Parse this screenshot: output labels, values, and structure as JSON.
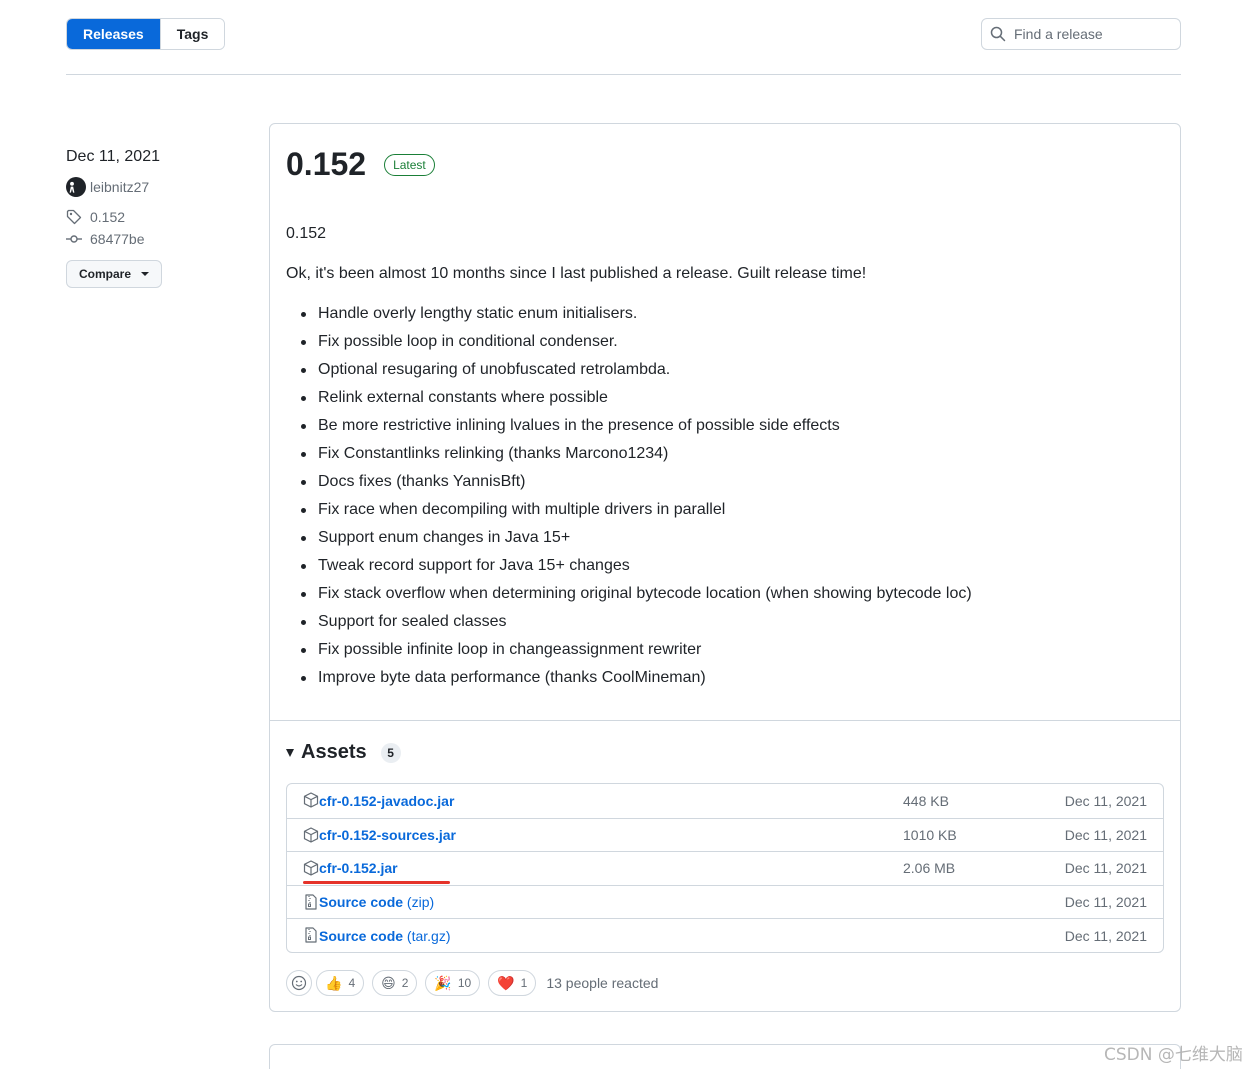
{
  "tabs": [
    {
      "label": "Releases",
      "active": true
    },
    {
      "label": "Tags",
      "active": false
    }
  ],
  "search": {
    "placeholder": "Find a release",
    "icon": "search-icon"
  },
  "release": {
    "date": "Dec 11, 2021",
    "author": "leibnitz27",
    "tag": "0.152",
    "commit": "68477be",
    "compare_label": "Compare",
    "version": "0.152",
    "latest_label": "Latest",
    "body": {
      "heading": "0.152",
      "intro": "Ok, it's been almost 10 months since I last published a release. Guilt release time!",
      "items": [
        "Handle overly lengthy static enum initialisers.",
        "Fix possible loop in conditional condenser.",
        "Optional resugaring of unobfuscated retrolambda.",
        "Relink external constants where possible",
        "Be more restrictive inlining lvalues in the presence of possible side effects",
        "Fix Constantlinks relinking (thanks Marcono1234)",
        "Docs fixes (thanks YannisBft)",
        "Fix race when decompiling with multiple drivers in parallel",
        "Support enum changes in Java 15+",
        "Tweak record support for Java 15+ changes",
        "Fix stack overflow when determining original bytecode location (when showing bytecode loc)",
        "Support for sealed classes",
        "Fix possible infinite loop in changeassignment rewriter",
        "Improve byte data performance (thanks CoolMineman)"
      ]
    },
    "assets": {
      "title": "Assets",
      "count": "5",
      "files": [
        {
          "name": "cfr-0.152-javadoc.jar",
          "ext": "",
          "size": "448 KB",
          "date": "Dec 11, 2021",
          "icon": "package-icon"
        },
        {
          "name": "cfr-0.152-sources.jar",
          "ext": "",
          "size": "1010 KB",
          "date": "Dec 11, 2021",
          "icon": "package-icon"
        },
        {
          "name": "cfr-0.152.jar",
          "ext": "",
          "size": "2.06 MB",
          "date": "Dec 11, 2021",
          "icon": "package-icon"
        },
        {
          "name": "Source code",
          "ext": "(zip)",
          "size": "",
          "date": "Dec 11, 2021",
          "icon": "file-zip-icon"
        },
        {
          "name": "Source code",
          "ext": "(tar.gz)",
          "size": "",
          "date": "Dec 11, 2021",
          "icon": "file-zip-icon"
        }
      ]
    },
    "reactions": [
      {
        "emoji": "👍",
        "count": "4"
      },
      {
        "emoji": "😄",
        "count": "2"
      },
      {
        "emoji": "🎉",
        "count": "10"
      },
      {
        "emoji": "❤️",
        "count": "1"
      }
    ],
    "reaction_summary": "13 people reacted"
  },
  "watermark": "CSDN @七维大脑",
  "colors": {
    "accent": "#0969da",
    "latest_green": "#1a7f37",
    "highlight_red": "#e5332a"
  }
}
